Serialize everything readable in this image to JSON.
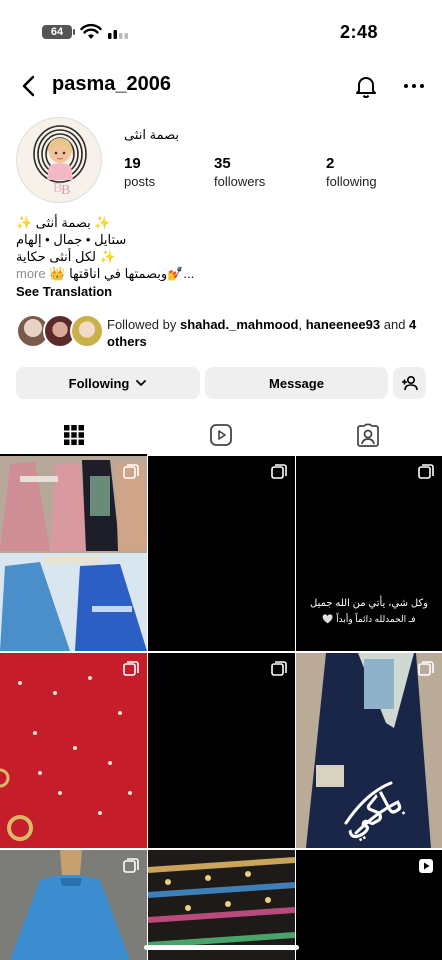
{
  "status_bar": {
    "battery": "64",
    "time": "2:48"
  },
  "header": {
    "username": "pasma_2006",
    "back_icon": "chevron-left-icon",
    "bell_icon": "bell-icon",
    "more_icon": "more-horizontal-icon"
  },
  "profile": {
    "display_name": "بصمة انثى",
    "stats": [
      {
        "value": "19",
        "label": "posts"
      },
      {
        "value": "35",
        "label": "followers"
      },
      {
        "value": "2",
        "label": "following"
      }
    ],
    "bio": {
      "line1": "✨ بصمة أنثى ✨",
      "line2": "ستايل • جمال • إلهام",
      "line3": "✨ لكل أنثى حكاية",
      "line4": "👑 وبصمتها في اناقتها💅...",
      "more": "more"
    },
    "see_translation": "See Translation",
    "followed_by": {
      "prefix": "Followed by ",
      "user1": "shahad._mahmood",
      "sep": ", ",
      "user2": "haneenee93",
      "and": " and ",
      "others": "4 others"
    }
  },
  "buttons": {
    "following": "Following",
    "message": "Message"
  },
  "tabs": [
    {
      "name": "posts-grid",
      "icon": "grid-icon",
      "active": true
    },
    {
      "name": "reels",
      "icon": "reels-icon",
      "active": false
    },
    {
      "name": "tagged",
      "icon": "tagged-user-icon",
      "active": false
    }
  ],
  "grid": {
    "post3_caption_line1": "وكل شي، يأتي من الله جميل",
    "post3_caption_line2": "فـ الحمدلله دائماً وأبداً 🤍",
    "post6_overlay_text": "باكي"
  },
  "colors": {
    "accent": "#000000",
    "button_bg": "#efefef",
    "link_muted": "#8e8e8e"
  }
}
